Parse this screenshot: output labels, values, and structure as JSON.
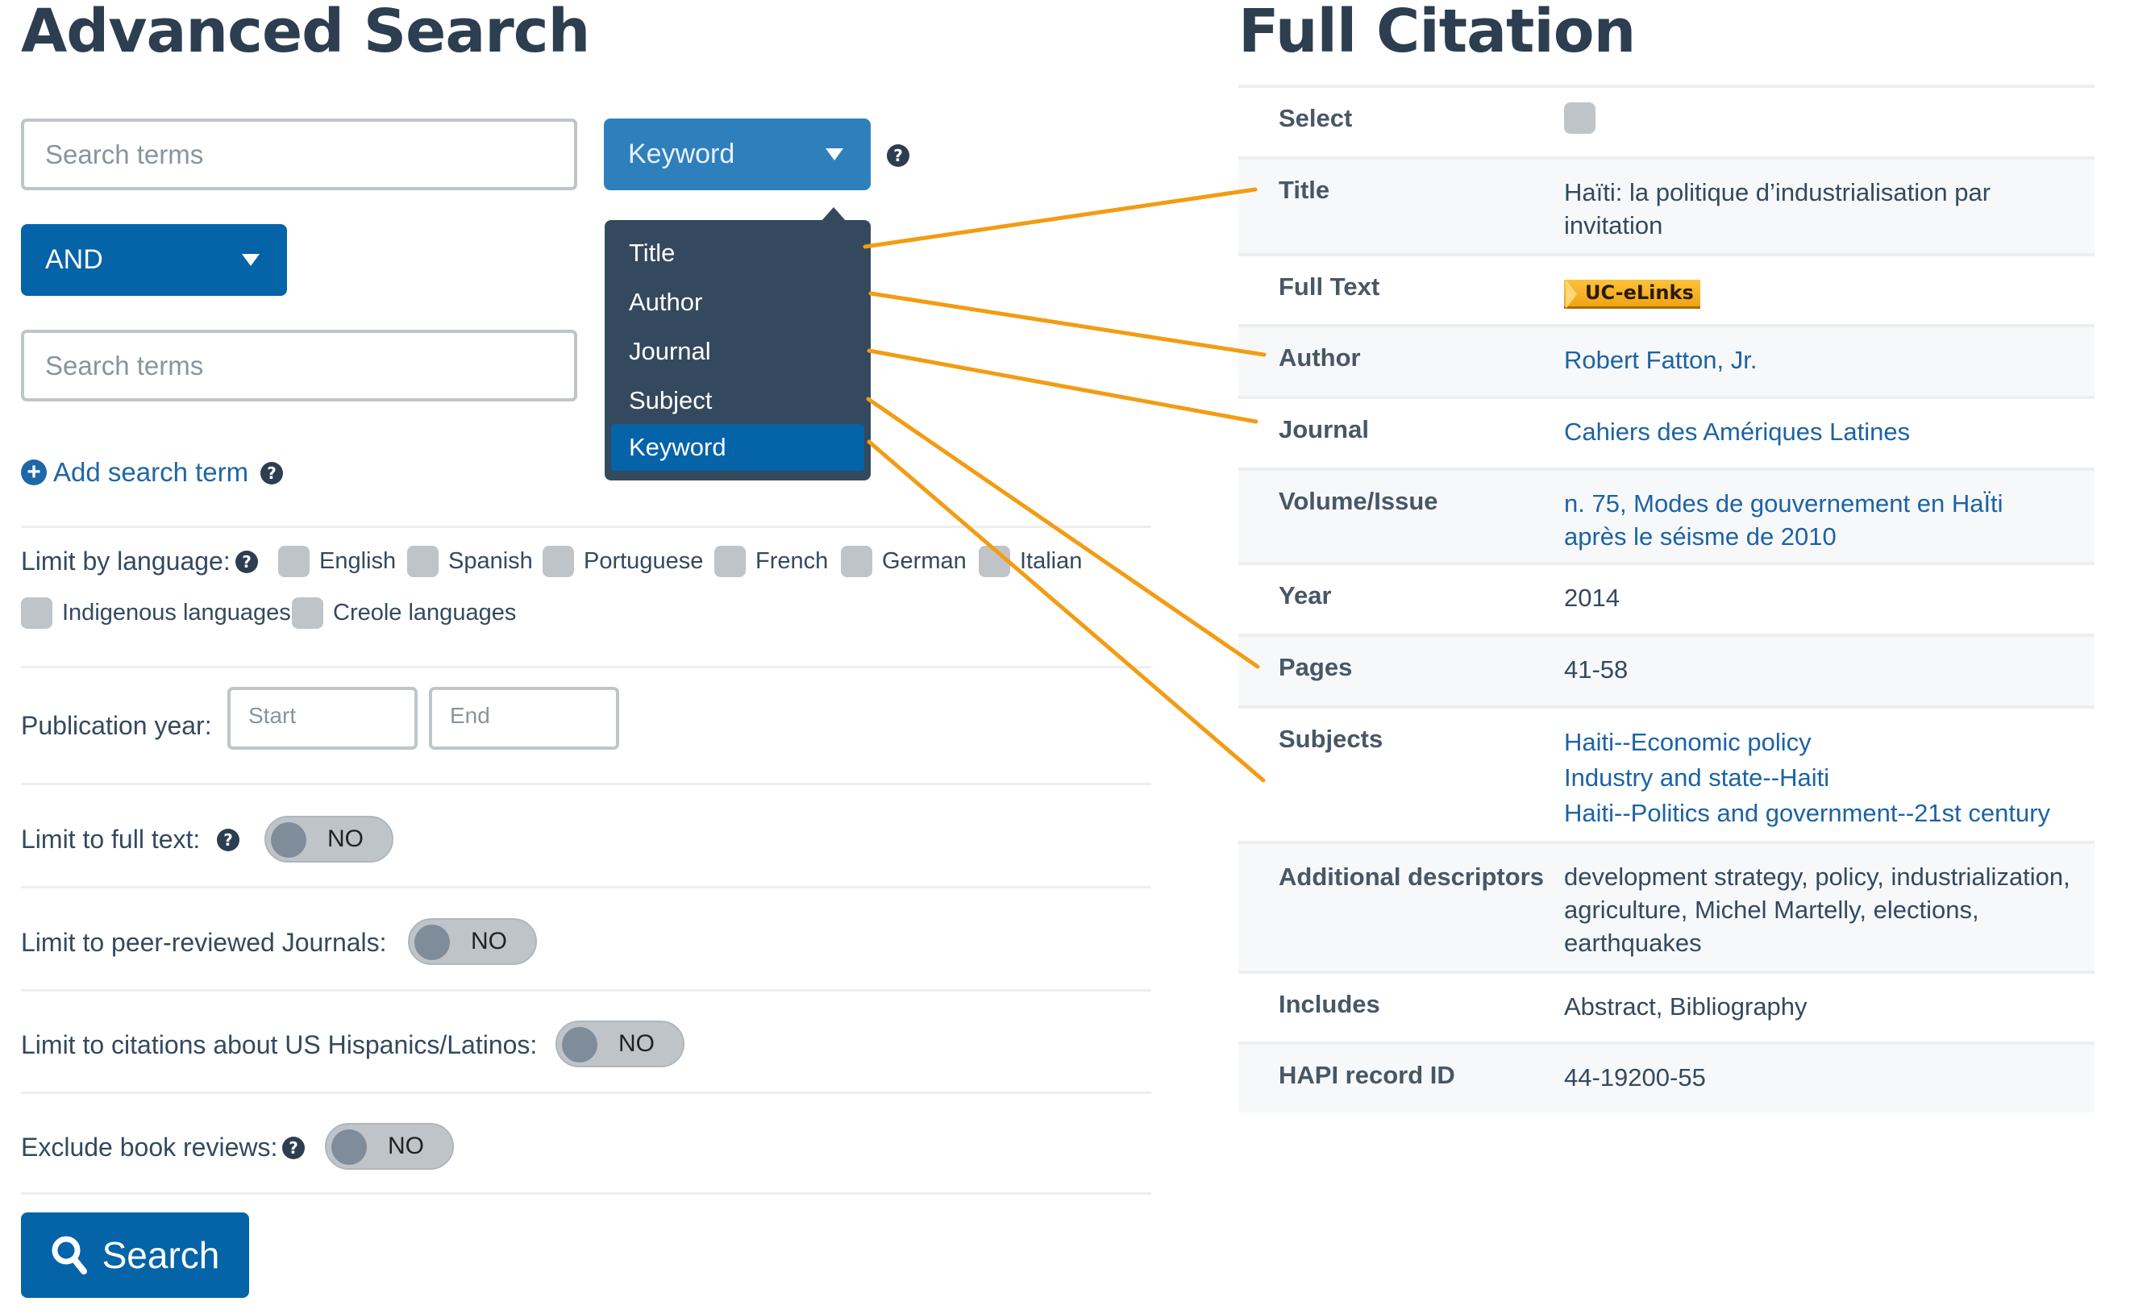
{
  "advanced_search": {
    "title": "Advanced Search",
    "search_term_1": {
      "placeholder": "Search terms",
      "value": ""
    },
    "field_select": {
      "selected": "Keyword",
      "options": [
        "Title",
        "Author",
        "Journal",
        "Subject",
        "Keyword"
      ]
    },
    "help_icon": "?",
    "boolean_select": {
      "selected": "AND"
    },
    "search_term_2": {
      "placeholder": "Search terms",
      "value": ""
    },
    "add_search_term_label": "Add search term",
    "language": {
      "label": "Limit by language:",
      "options": [
        {
          "label": "English",
          "checked": false
        },
        {
          "label": "Spanish",
          "checked": false
        },
        {
          "label": "Portuguese",
          "checked": false
        },
        {
          "label": "French",
          "checked": false
        },
        {
          "label": "German",
          "checked": false
        },
        {
          "label": "Italian",
          "checked": false
        },
        {
          "label": "Indigenous languages",
          "checked": false
        },
        {
          "label": "Creole languages",
          "checked": false
        }
      ]
    },
    "publication_year": {
      "label": "Publication year:",
      "start_placeholder": "Start",
      "end_placeholder": "End"
    },
    "toggles": [
      {
        "label": "Limit to full text:",
        "state": "NO",
        "has_help": true
      },
      {
        "label": "Limit to peer-reviewed Journals:",
        "state": "NO",
        "has_help": false
      },
      {
        "label": "Limit to citations about US Hispanics/Latinos:",
        "state": "NO",
        "has_help": false
      },
      {
        "label": "Exclude book reviews:",
        "state": "NO",
        "has_help": true
      }
    ],
    "search_button_label": "Search"
  },
  "full_citation": {
    "title": "Full Citation",
    "rows": [
      {
        "key": "Select",
        "type": "checkbox"
      },
      {
        "key": "Title",
        "value": "Haïti: la politique d’industrialisation par invitation"
      },
      {
        "key": "Full Text",
        "type": "badge",
        "value": "UC-eLinks"
      },
      {
        "key": "Author",
        "value": "Robert Fatton, Jr.",
        "link": true
      },
      {
        "key": "Journal",
        "value": "Cahiers des Amériques Latines",
        "link": true
      },
      {
        "key": "Volume/Issue",
        "value": "n. 75, Modes de gouvernement en HaÏti après le séisme de 2010",
        "link": true
      },
      {
        "key": "Year",
        "value": "2014"
      },
      {
        "key": "Pages",
        "value": "41-58"
      },
      {
        "key": "Subjects",
        "values": [
          "Haiti--Economic policy",
          "Industry and state--Haiti",
          "Haiti--Politics and government--21st century"
        ],
        "link": true
      },
      {
        "key": "Additional descriptors",
        "value": "development strategy, policy, industrialization, agriculture, Michel Martelly, elections, earthquakes"
      },
      {
        "key": "Includes",
        "value": "Abstract, Bibliography"
      },
      {
        "key": "HAPI record ID",
        "value": "44-19200-55"
      }
    ]
  },
  "annotation": {
    "color": "#f39c12",
    "links": [
      {
        "from": "Title",
        "to": "Title"
      },
      {
        "from": "Author",
        "to": "Author"
      },
      {
        "from": "Journal",
        "to": "Journal"
      },
      {
        "from": "Subject",
        "to": "Subjects"
      },
      {
        "from": "Keyword",
        "to": "Additional descriptors"
      }
    ]
  },
  "colors": {
    "heading": "#2c3e50",
    "primary": "#0563a8",
    "select_blue": "#2e80bd",
    "dropdown_bg": "#34495e",
    "link": "#1c63a4"
  }
}
